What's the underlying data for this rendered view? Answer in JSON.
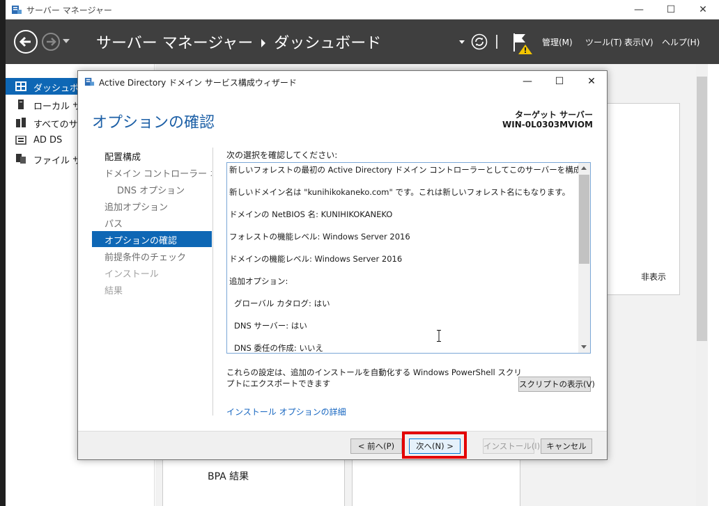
{
  "server_manager": {
    "window_title": "サーバー マネージャー",
    "breadcrumb": [
      "サーバー マネージャー",
      "ダッシュボード"
    ],
    "menu": [
      "管理(M)",
      "ツール(T)",
      "表示(V)",
      "ヘルプ(H)"
    ],
    "sidebar": [
      {
        "label": "ダッシュボード",
        "icon": "dashboard-icon",
        "active": true
      },
      {
        "label": "ローカル サーバー",
        "icon": "server-icon",
        "active": false
      },
      {
        "label": "すべてのサーバー",
        "icon": "servers-icon",
        "active": false
      },
      {
        "label": "AD DS",
        "icon": "adds-icon",
        "active": false
      },
      {
        "label": "ファイル サービス",
        "icon": "file-services-icon",
        "active": false
      }
    ],
    "hide_label": "非表示",
    "bpa_label": "BPA 結果"
  },
  "wizard": {
    "title": "Active Directory ドメイン サービス構成ウィザード",
    "heading": "オプションの確認",
    "target_label": "ターゲット サーバー",
    "target_name": "WIN-0L0303MVIOM",
    "nav": [
      {
        "label": "配置構成",
        "state": "normal"
      },
      {
        "label": "ドメイン コントローラー オプション",
        "state": "grey"
      },
      {
        "label": "DNS オプション",
        "state": "grey",
        "sub": true
      },
      {
        "label": "追加オプション",
        "state": "grey"
      },
      {
        "label": "パス",
        "state": "grey"
      },
      {
        "label": "オプションの確認",
        "state": "active"
      },
      {
        "label": "前提条件のチェック",
        "state": "grey"
      },
      {
        "label": "インストール",
        "state": "disabled"
      },
      {
        "label": "結果",
        "state": "disabled"
      }
    ],
    "confirm_label": "次の選択を確認してください:",
    "review_lines": [
      "新しいフォレストの最初の Active Directory ドメイン コントローラーとしてこのサーバーを構成します。",
      "新しいドメイン名は \"kunihikokaneko.com\" です。これは新しいフォレスト名にもなります。",
      "ドメインの NetBIOS 名: KUNIHIKOKANEKO",
      "フォレストの機能レベル: Windows Server 2016",
      "ドメインの機能レベル: Windows Server 2016",
      "追加オプション:",
      "グローバル カタログ: はい",
      "DNS サーバー: はい",
      "DNS 委任の作成: いいえ"
    ],
    "ps_note": "これらの設定は、追加のインストールを自動化する Windows PowerShell スクリプトにエクスポートできます",
    "script_button": "スクリプトの表示(V)",
    "detail_link": "インストール オプションの詳細",
    "buttons": {
      "prev": "< 前へ(P)",
      "next": "次へ(N) >",
      "install": "インストール(I)",
      "cancel": "キャンセル"
    },
    "highlight_color": "#e30000",
    "accent_color": "#0e67b5"
  }
}
